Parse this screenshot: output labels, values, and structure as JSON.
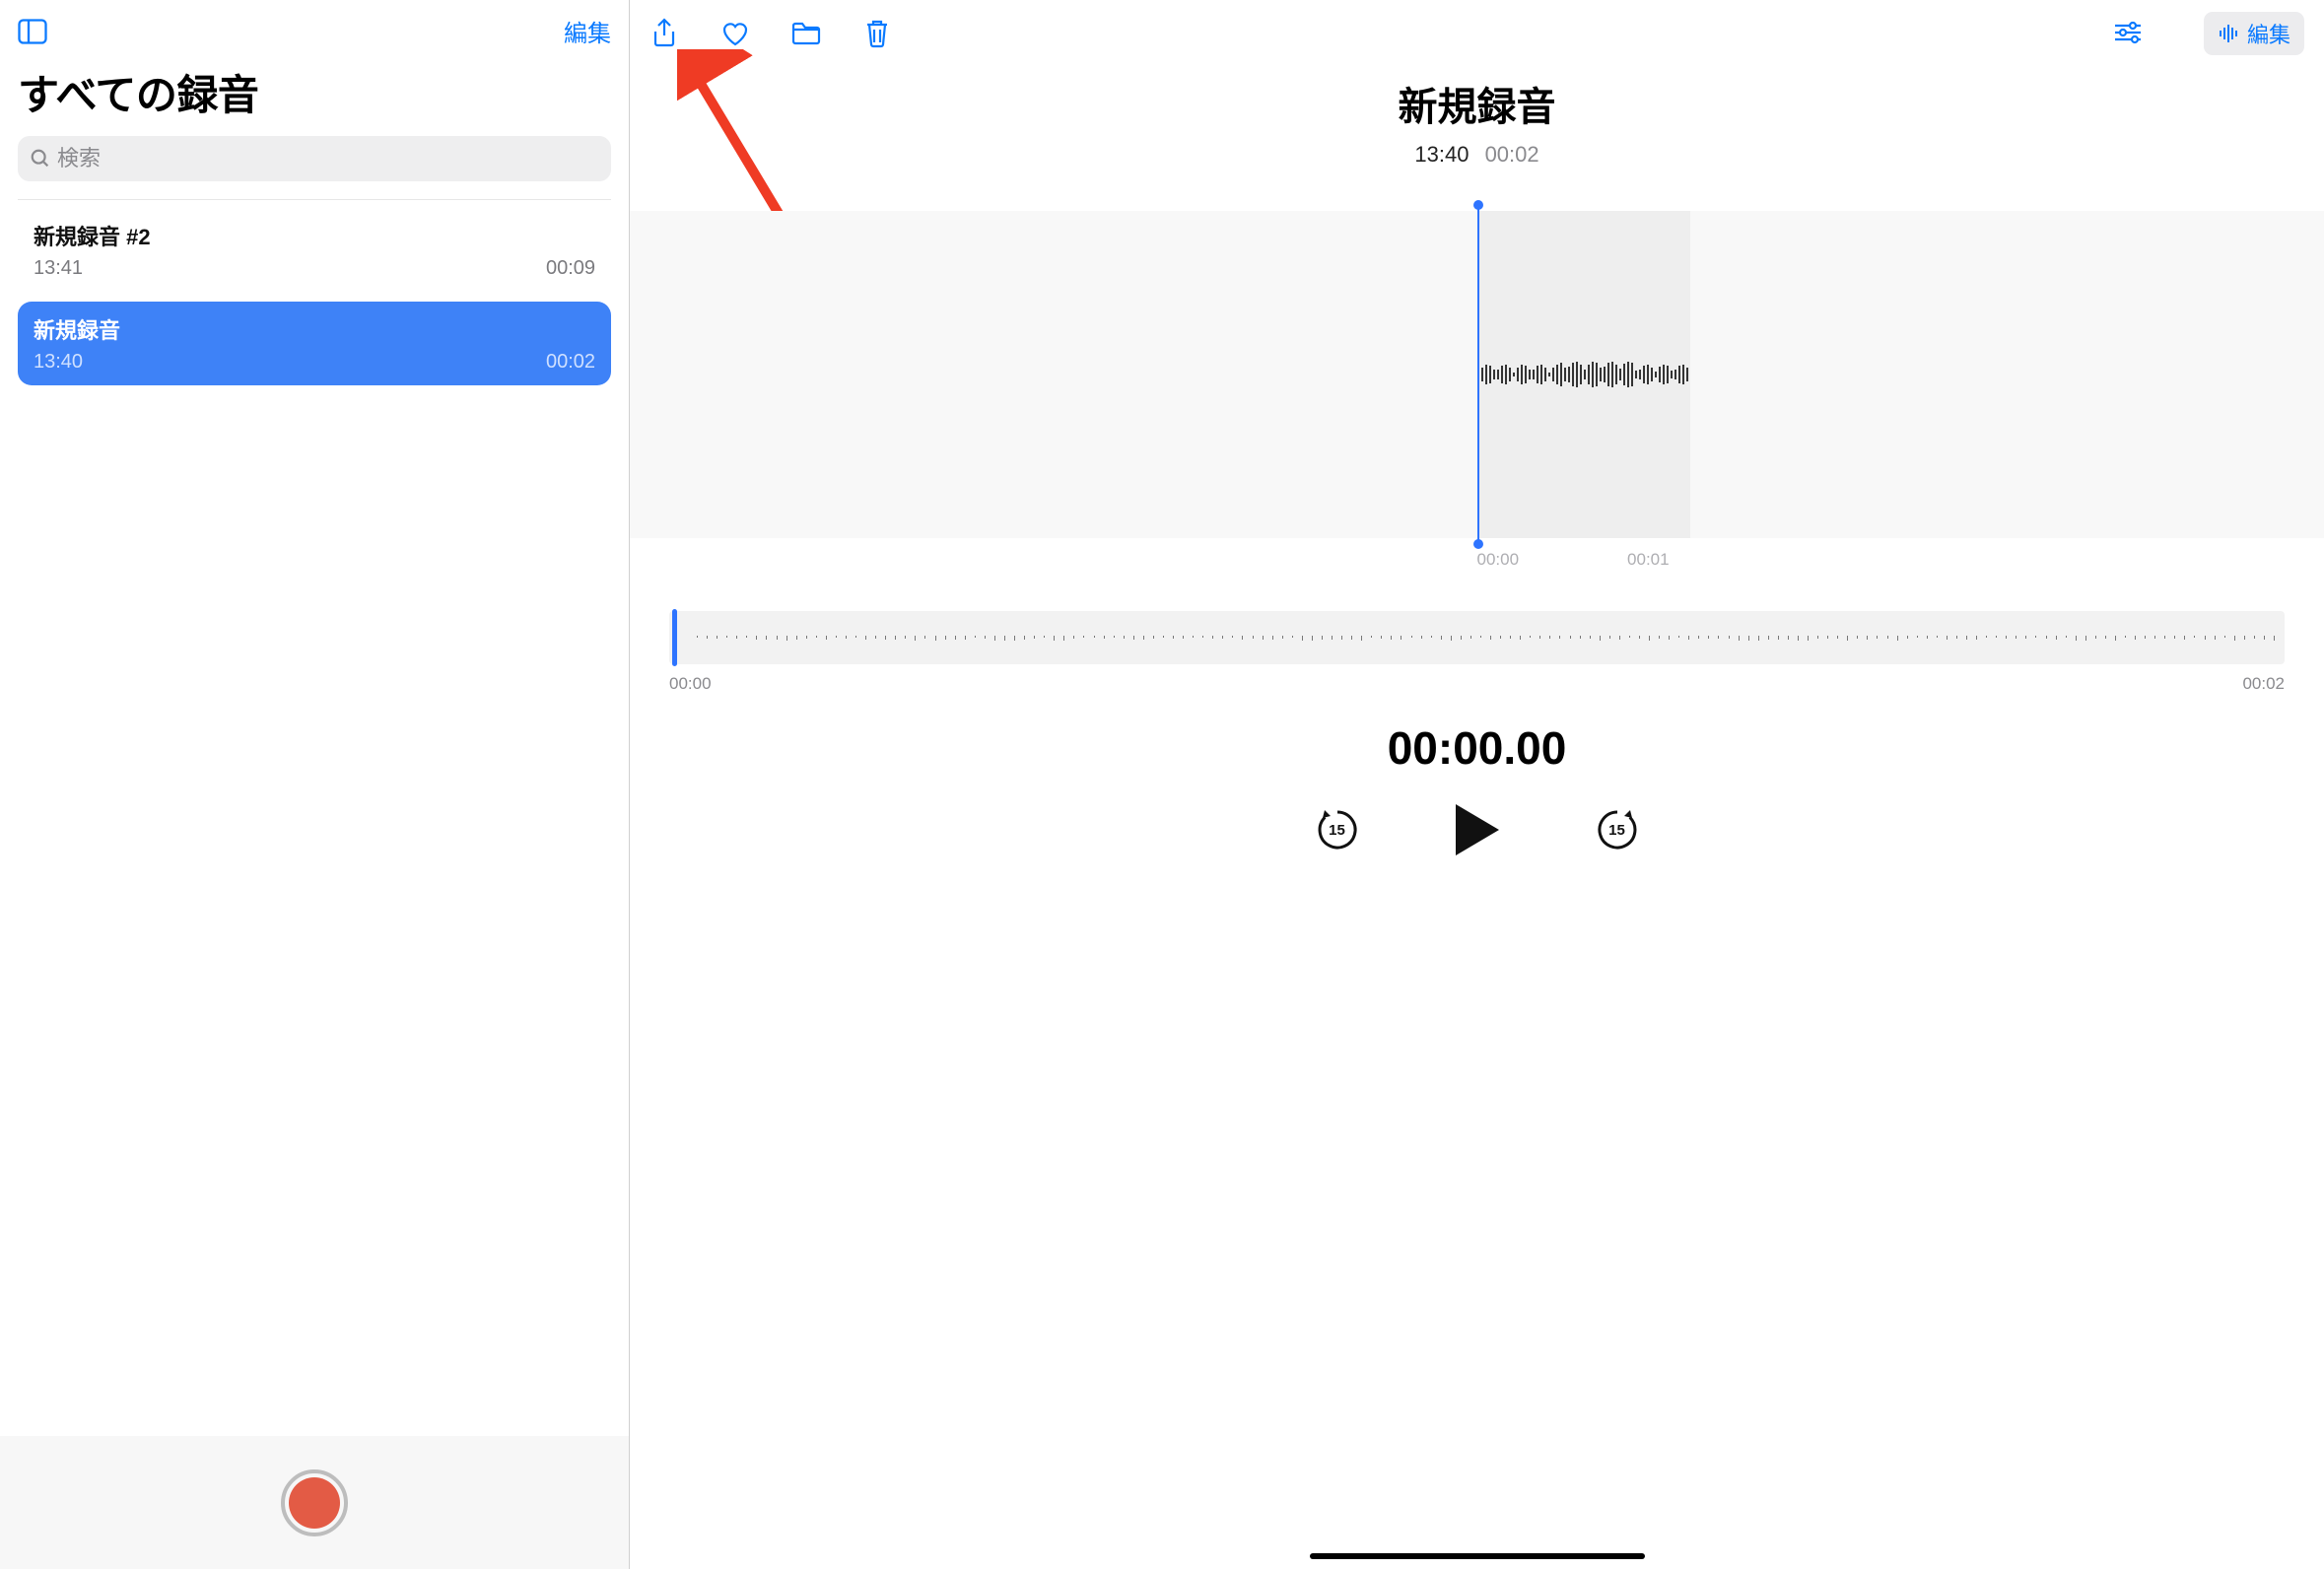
{
  "sidebar": {
    "edit_label": "編集",
    "title": "すべての録音",
    "search_placeholder": "検索",
    "recordings": [
      {
        "title": "新規録音 #2",
        "time": "13:41",
        "duration": "00:09",
        "selected": false
      },
      {
        "title": "新規録音",
        "time": "13:40",
        "duration": "00:02",
        "selected": true
      }
    ]
  },
  "main": {
    "title": "新規録音",
    "subtitle_time": "13:40",
    "subtitle_duration": "00:02",
    "edit_pill_label": "編集",
    "wave_ticks": [
      "00:00",
      "00:01"
    ],
    "scrub_start": "00:00",
    "scrub_end": "00:02",
    "timecode": "00:00.00",
    "skip_seconds": "15"
  },
  "colors": {
    "accent": "#0a7aff",
    "record": "#e35b45",
    "selection": "#3e82f7"
  }
}
